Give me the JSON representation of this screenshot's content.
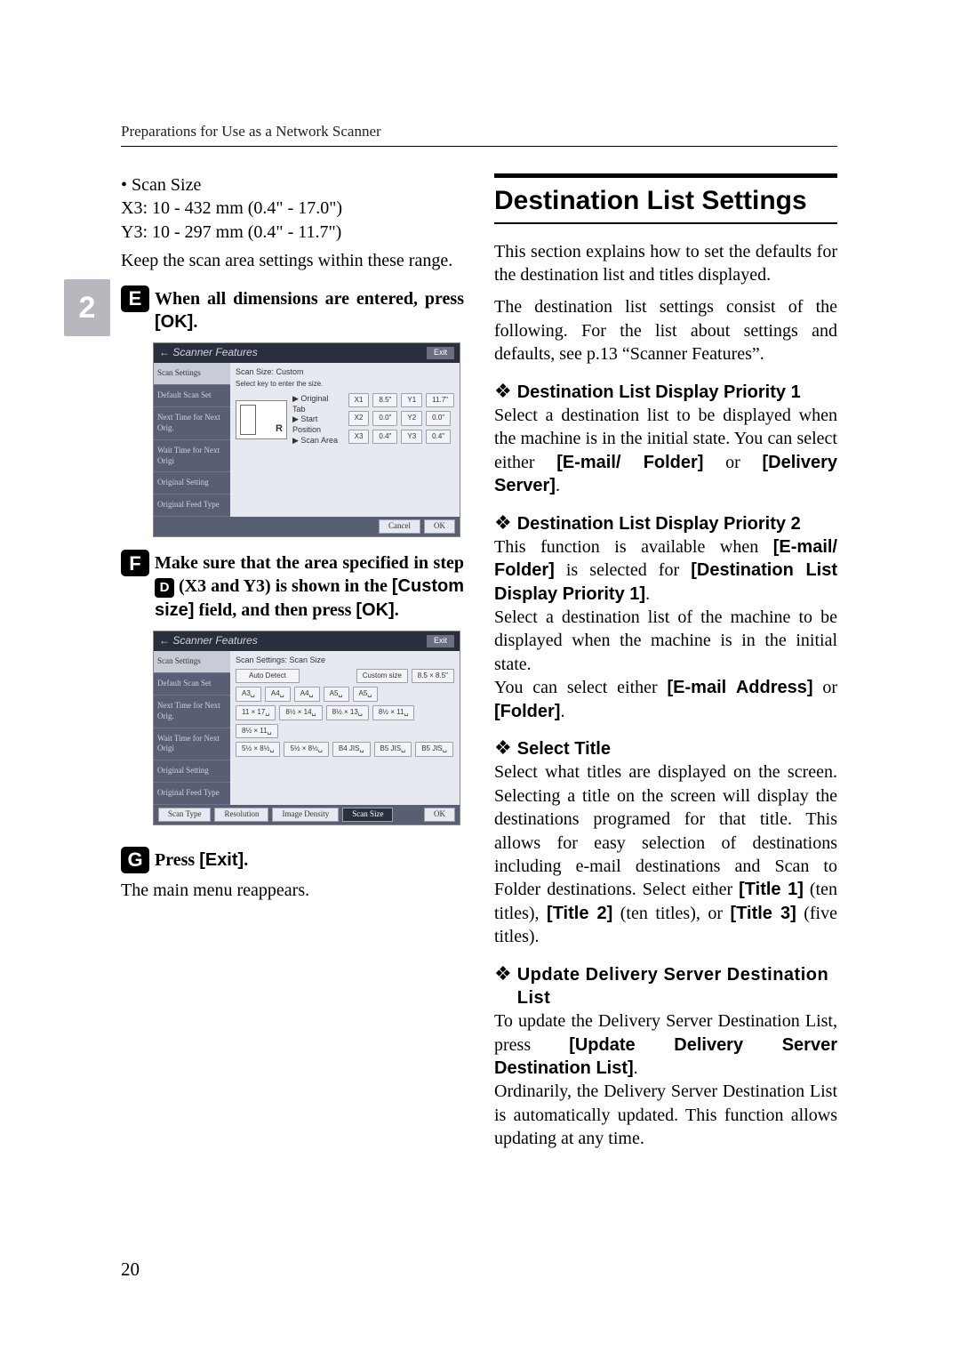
{
  "running_head": "Preparations for Use as a Network Scanner",
  "side_tab": "2",
  "page_number": "20",
  "left": {
    "bullet_scan_size": "Scan Size",
    "scan_x3": "X3: 10 - 432 mm (0.4\" - 17.0\")",
    "scan_y3": "Y3: 10 - 297 mm (0.4\" - 11.7\")",
    "keep_range": "Keep the scan area settings within these range.",
    "step5_a": "When all dimensions are entered, press ",
    "step5_ok": "[OK]",
    "step5_b": ".",
    "step6_a": "Make sure that the area specified in step ",
    "step6_ref": "D",
    "step6_b": " (X3 and Y3) is shown in the ",
    "step6_custom": "[Custom size]",
    "step6_c": " field, and then press ",
    "step6_ok": "[OK]",
    "step6_d": ".",
    "step7_a": "Press ",
    "step7_exit": "[Exit]",
    "step7_b": ".",
    "main_menu": "The main menu reappears.",
    "step5_num": "E",
    "step6_num": "F",
    "step7_num": "G",
    "shot1": {
      "title": "Scanner Features",
      "exit": "Exit",
      "tabs": [
        "Scan Settings",
        "Default Scan Set",
        "Next Time for Next Orig.",
        "Wait Time for Next Origi",
        "Original Setting",
        "Original Feed Type"
      ],
      "main_header": "Scan Size: Custom",
      "sub": "Select key to enter the size.",
      "rows": [
        "▶ Original Tab",
        "▶ Start Position",
        "▶ Scan Area"
      ],
      "xs": [
        "X1",
        "X2",
        "X3"
      ],
      "xvals": [
        "8.5\"",
        "0.0\"",
        "0.4\""
      ],
      "ys": [
        "Y1",
        "Y2",
        "Y3"
      ],
      "yvals": [
        "11.7\"",
        "0.0\"",
        "0.4\""
      ],
      "cancel": "Cancel",
      "ok": "OK"
    },
    "shot2": {
      "title": "Scanner Features",
      "exit": "Exit",
      "tabs": [
        "Scan Settings",
        "Default Scan Set",
        "Next Time for Next Orig.",
        "Wait Time for Next Origi",
        "Original Setting",
        "Original Feed Type"
      ],
      "main_header": "Scan Settings: Scan Size",
      "auto": "Auto Detect",
      "custom_label": "Custom size",
      "custom_val": "8.5 × 8.5\"",
      "sizes": [
        "A3␣",
        "A4␣",
        "A4␣",
        "A5␣",
        "A5␣",
        "11 × 17␣",
        "8½ × 14␣",
        "8½ × 13␣",
        "8½ × 11␣",
        "8½ × 11␣",
        "5½ × 8½␣",
        "5½ × 8½␣",
        "B4 JIS␣",
        "B5 JIS␣",
        "B5 JIS␣"
      ],
      "bottom": [
        "Scan Type",
        "Resolution",
        "Image Density",
        "Scan Size"
      ],
      "ok": "OK"
    }
  },
  "right": {
    "h1": "Destination List Settings",
    "p1": "This section explains how to set the defaults for the destination list and titles displayed.",
    "p2a": "The destination list settings consist of the following. For the list about settings and defaults, see p.13 “Scanner Features”.",
    "d1_title": "Destination List Display Priority 1",
    "d1_body_a": "Select a destination list to be displayed when the machine is in the initial state. You can select either ",
    "d1_opt1": "[E-mail/ Folder]",
    "d1_or": " or ",
    "d1_opt2": "[Delivery Server]",
    "d1_body_b": ".",
    "d2_title": "Destination List Display Priority 2",
    "d2_body_a": "This function is available when ",
    "d2_opt1": "[E-mail/ Folder]",
    "d2_body_b": " is selected for ",
    "d2_opt2": "[Destination List Display Priority 1]",
    "d2_body_c": ".",
    "d2_body_d": "Select a destination list of the machine to be displayed when the machine is in the initial state.",
    "d2_body_e": "You can select either ",
    "d2_opt3": "[E-mail Address]",
    "d2_or": " or ",
    "d2_opt4": "[Folder]",
    "d2_body_f": ".",
    "d3_title": "Select Title",
    "d3_body_a": "Select what titles are displayed on the screen. Selecting a title on the screen will display the destinations programed for that title. This allows for easy selection of destinations including e-mail destinations and Scan to Folder destinations. Select either ",
    "d3_opt1": "[Title 1]",
    "d3_body_b": " (ten titles), ",
    "d3_opt2": "[Title 2]",
    "d3_body_c": " (ten titles), or ",
    "d3_opt3": "[Title 3]",
    "d3_body_d": " (five titles).",
    "d4_title": "Update Delivery Server Destination List",
    "d4_body_a": "To update the Delivery Server Destination List, press ",
    "d4_opt1": "[Update Delivery Server Destination List]",
    "d4_body_b": ".",
    "d4_body_c": "Ordinarily, the Delivery Server Destination List is automatically updated. This function allows updating at any time."
  }
}
